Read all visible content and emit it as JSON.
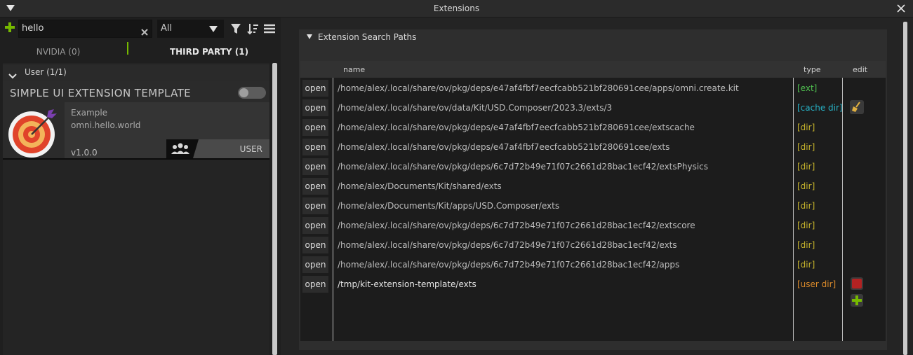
{
  "window": {
    "title": "Extensions"
  },
  "toolbar": {
    "search_value": "hello",
    "filter_select": "All"
  },
  "tabs": [
    {
      "label": "NVIDIA (0)"
    },
    {
      "label": "THIRD PARTY (1)"
    }
  ],
  "group": {
    "label": "User (1/1)"
  },
  "extension": {
    "title": "SIMPLE UI EXTENSION TEMPLATE",
    "category": "Example",
    "id": "omni.hello.world",
    "version": "v1.0.0",
    "badge": "USER",
    "enabled": false
  },
  "search_paths": {
    "section_title": "Extension Search Paths",
    "columns": {
      "name": "name",
      "type": "type",
      "edit": "edit"
    },
    "open_label": "open",
    "rows": [
      {
        "path": "/home/alex/.local/share/ov/pkg/deps/e47af4fbf7eecfcabb521bf280691cee/apps/omni.create.kit",
        "type": "[ext]",
        "type_color": "#4fbf4f"
      },
      {
        "path": "/home/alex/.local/share/ov/data/Kit/USD.Composer/2023.3/exts/3",
        "type": "[cache dir]",
        "type_color": "#27b3c7"
      },
      {
        "path": "/home/alex/.local/share/ov/pkg/deps/e47af4fbf7eecfcabb521bf280691cee/extscache",
        "type": "[dir]",
        "type_color": "#c7b42c"
      },
      {
        "path": "/home/alex/.local/share/ov/pkg/deps/e47af4fbf7eecfcabb521bf280691cee/exts",
        "type": "[dir]",
        "type_color": "#c7b42c"
      },
      {
        "path": "/home/alex/.local/share/ov/pkg/deps/6c7d72b49e71f07c2661d28bac1ecf42/extsPhysics",
        "type": "[dir]",
        "type_color": "#c7b42c"
      },
      {
        "path": "/home/alex/Documents/Kit/shared/exts",
        "type": "[dir]",
        "type_color": "#c7b42c"
      },
      {
        "path": "/home/alex/Documents/Kit/apps/USD.Composer/exts",
        "type": "[dir]",
        "type_color": "#c7b42c"
      },
      {
        "path": "/home/alex/.local/share/ov/pkg/deps/6c7d72b49e71f07c2661d28bac1ecf42/extscore",
        "type": "[dir]",
        "type_color": "#c7b42c"
      },
      {
        "path": "/home/alex/.local/share/ov/pkg/deps/6c7d72b49e71f07c2661d28bac1ecf42/exts",
        "type": "[dir]",
        "type_color": "#c7b42c"
      },
      {
        "path": "/home/alex/.local/share/ov/pkg/deps/6c7d72b49e71f07c2661d28bac1ecf42/apps",
        "type": "[dir]",
        "type_color": "#c7b42c"
      },
      {
        "path": "/tmp/kit-extension-template/exts",
        "type": "[user dir]",
        "type_color": "#d9892a"
      }
    ]
  },
  "colors": {
    "accent_green": "#76b900",
    "delete_red": "#b22222",
    "broom_yellow": "#e0b040"
  }
}
